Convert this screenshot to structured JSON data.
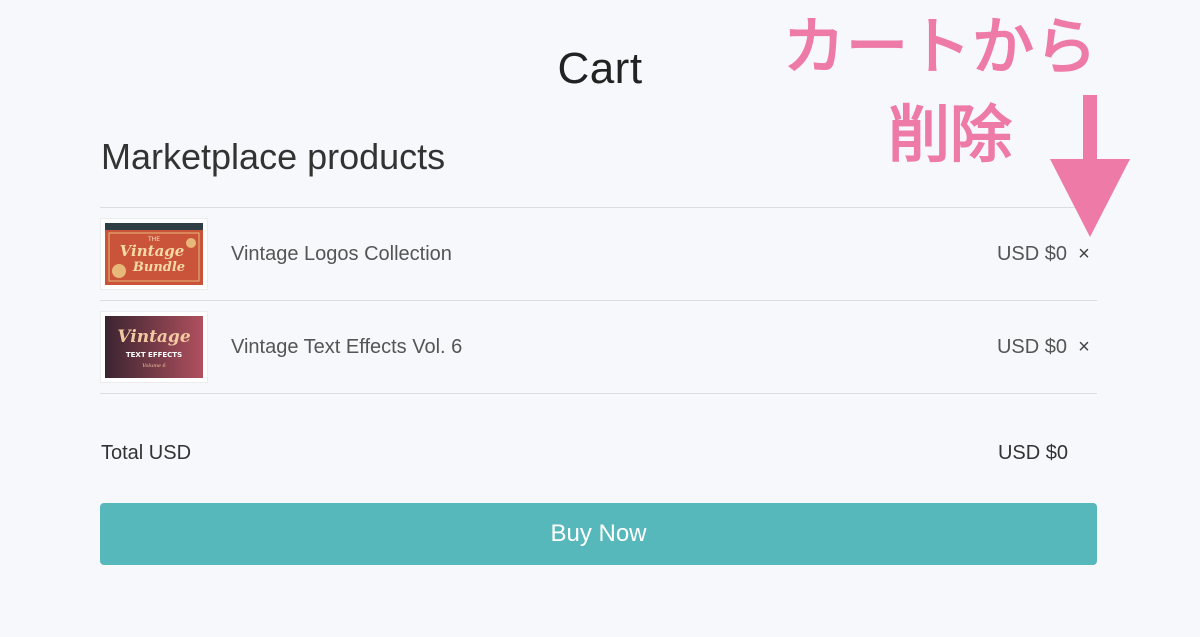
{
  "page": {
    "title": "Cart",
    "section_title": "Marketplace products"
  },
  "cart": {
    "items": [
      {
        "name": "Vintage Logos Collection",
        "price": "USD $0",
        "remove_label": "×",
        "thumbnail": {
          "text_top": "THE",
          "text_main": "Vintage",
          "text_sub": "Bundle",
          "bg_color": "#c9543a"
        }
      },
      {
        "name": "Vintage Text Effects Vol. 6",
        "price": "USD $0",
        "remove_label": "×",
        "thumbnail": {
          "text_main": "Vintage",
          "text_sub": "TEXT EFFECTS",
          "text_vol": "Volume 6",
          "bg_color": "#5a2d3a"
        }
      }
    ]
  },
  "total": {
    "label": "Total USD",
    "value": "USD $0"
  },
  "buy_button": {
    "label": "Buy Now"
  },
  "annotation": {
    "line1": "カートから",
    "line2": "削除",
    "color": "#ee7aa7"
  },
  "colors": {
    "background": "#f7f8fc",
    "button": "#57b8bb",
    "divider": "#dcdde0"
  }
}
